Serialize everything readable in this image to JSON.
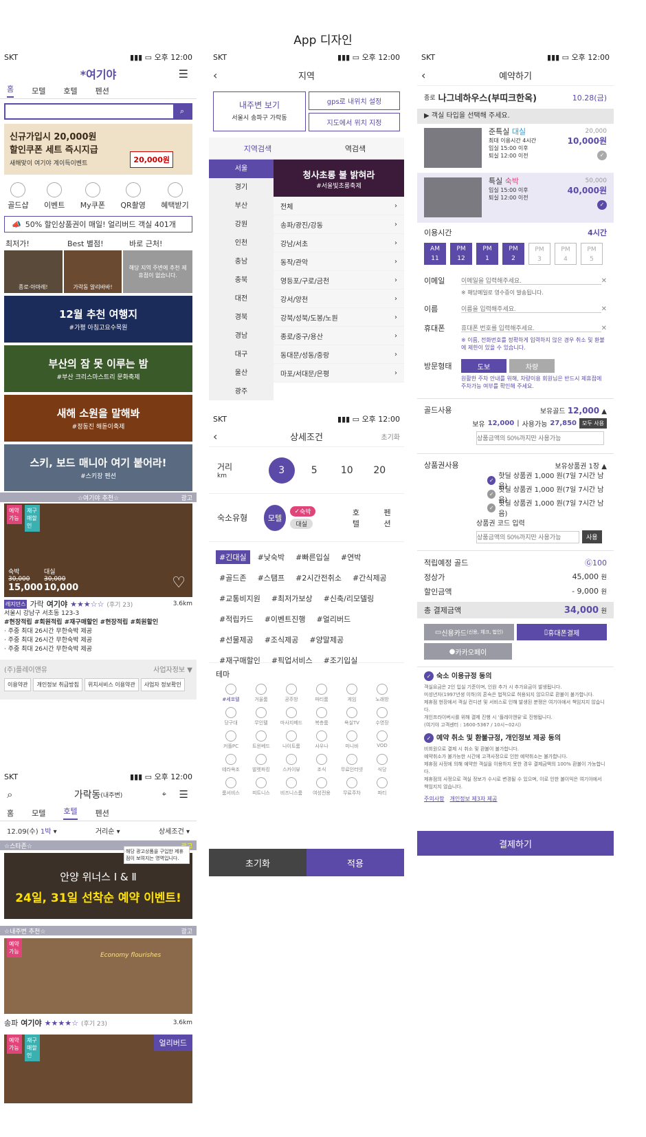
{
  "page_title": "App 디자인",
  "status": {
    "carrier": "SKT",
    "time": "오후 12:00"
  },
  "home": {
    "logo": "여기야",
    "tabs": [
      "홈",
      "모텔",
      "호텔",
      "펜션"
    ],
    "promo": {
      "line1": "신규가입시 20,000원",
      "line2": "할인쿠폰 세트 즉시지급",
      "sub": "새해맞이 여기야 계이득이벤트",
      "amount": "20,000원"
    },
    "quick": [
      "골드샵",
      "이벤트",
      "My쿠폰",
      "QR촬영",
      "혜택받기"
    ],
    "notice": "50% 할인상품권이 매일! 얼리버드 객실 401개",
    "recs": {
      "labels": [
        "최저가!",
        "Best 별점!",
        "바로 근처!"
      ],
      "thumb1": "종로·아마레!",
      "thumb2": "가락동 알리바바!",
      "thumb3": "해당 지역 주변에 추천 제휴점이 없습니다."
    },
    "banners": [
      {
        "title": "12월 추천 여행지",
        "tag": "#가평 아침고요수목원",
        "bg": "#1b2b5a"
      },
      {
        "title": "부산의 잠 못 이루는 밤",
        "tag": "#부산 크리스마스트리 문화축제",
        "bg": "#3a5a2a"
      },
      {
        "title": "새해 소원을 말해봐",
        "tag": "#정동진 해돋이축제",
        "bg": "#7a3a14"
      },
      {
        "title": "스키, 보드 매니아 여기 붙어라!",
        "tag": "#스키장 펜션",
        "bg": "#5a6a80"
      }
    ],
    "section": "☆여기야 추천☆",
    "ad": "광고",
    "card": {
      "badge1": "예약가능",
      "badge2": "재구매할인",
      "stay_label": "숙박",
      "stay_old": "30,000",
      "stay_price": "15,000",
      "day_label": "대실",
      "day_old": "30,000",
      "day_price": "10,000",
      "tag": "레지던스",
      "name_pre": "가락",
      "name": "여기야",
      "reviews": "(후기 23)",
      "dist": "3.6km",
      "addr": "서울시 강남구 서초동 123-3",
      "tags": "#현장적립 #회원적립 #재구매할인 #현장적립 #회원할인",
      "bullets": [
        "· 주중 최대 26시간 무한숙박 제공",
        "· 주중 최대 26시간 무한숙박 제공",
        "· 주중 최대 26시간 무한숙박 제공"
      ]
    },
    "footer": {
      "company": "(주)플레이앤유",
      "info": "사업자정보 ▼",
      "links": [
        "이용약관",
        "개인정보 취급방침",
        "위치서비스 이용약관",
        "사업자 정보확인"
      ]
    }
  },
  "list": {
    "location": "가락동",
    "loc_sub": "(내주변)",
    "tabs": [
      "홈",
      "모텔",
      "호텔",
      "펜션"
    ],
    "filters": {
      "date": "12.09(수)",
      "nights": "1박",
      "sort": "거리순",
      "detail": "상세조건"
    },
    "section1": "☆스타존☆",
    "ad": "광고",
    "tooltip": "해당 광고상품을 구입한 제휴점이 보여지는 영역입니다.",
    "star": {
      "title": "안양 위너스 Ⅰ & Ⅱ",
      "event": "24일, 31일 선착순 예약 이벤트!"
    },
    "section2": "☆내주변 추천☆",
    "card": {
      "badge": "예약가능",
      "sign": "Economy flourishes",
      "area": "송파",
      "name": "여기야",
      "reviews": "(후기 23)",
      "dist": "3.6km"
    },
    "card2": {
      "badge1": "예약가능",
      "badge2": "재구매할인",
      "label": "얼리버드"
    }
  },
  "region": {
    "header": "지역",
    "nearby": {
      "title": "내주변 보기",
      "addr": "서울시 송파구 가락동"
    },
    "gps": "gps로 내위치 설정",
    "map": "지도에서 위치 지정",
    "tabs": [
      "지역검색",
      "역검색"
    ],
    "left": [
      "서울",
      "경기",
      "부산",
      "강원",
      "인천",
      "충남",
      "충북",
      "대전",
      "경북",
      "경남",
      "대구",
      "울산",
      "광주"
    ],
    "festival": {
      "title": "청사초롱 불 밝혀라",
      "tag": "#서울빛초롱축제"
    },
    "right": [
      "전체",
      "송파/광진/강동",
      "강남/서초",
      "동작/관악",
      "영등포/구로/금천",
      "강서/양천",
      "강북/성북/도봉/노원",
      "종로/중구/용산",
      "동대문/성동/중랑",
      "마포/서대문/은평"
    ]
  },
  "detail": {
    "header": "상세조건",
    "reset_top": "초기화",
    "distance": {
      "label": "거리",
      "unit": "km",
      "values": [
        "3",
        "5",
        "10",
        "20"
      ],
      "selected": 0
    },
    "type": {
      "label": "숙소유형",
      "motel": "모텔",
      "sukbak": "숙박",
      "daesil": "대실",
      "hotel": "호텔",
      "pension": "펜션"
    },
    "chips": [
      "#긴대실",
      "#낮숙박",
      "#빠른입실",
      "#연박",
      "#골드존",
      "#스탬프",
      "#2시간전취소",
      "#간식제공",
      "#교통비지원",
      "#최저가보상",
      "#신축/리모델링",
      "#적립카드",
      "#이벤트진행",
      "#얼리버드",
      "#선물제공",
      "#조식제공",
      "#양말제공",
      "#재구매할인",
      "#픽업서비스",
      "#조기입실"
    ],
    "theme_label": "테마",
    "themes": [
      "#세호텔",
      "거울룸",
      "공주방",
      "파티룸",
      "게임",
      "노래방",
      "당구대",
      "무인텔",
      "마사지베드",
      "복층룸",
      "욕실TV",
      "수영장",
      "커플PC",
      "트윈베드",
      "나이트룸",
      "사우나",
      "미니바",
      "VOD",
      "테라욕조",
      "발렛파킹",
      "스카이뷰",
      "조식",
      "무료인터넷",
      "식당",
      "룸서비스",
      "피트니스",
      "비즈니스룸",
      "여성전용",
      "무료주차",
      "파티"
    ],
    "reset": "초기화",
    "apply": "적용"
  },
  "booking": {
    "header": "예약하기",
    "hotel": {
      "area": "종로",
      "name": "나그네하우스(부띠크한옥)",
      "date": "10.28(금)"
    },
    "select_msg": "▶ 객실 타입을 선택해 주세요.",
    "rooms": [
      {
        "name": "준특실",
        "type": "대실",
        "info1": "최대 이용시간 4시간",
        "info2": "입실 15:00 이후",
        "info3": "퇴실 12:00 이전",
        "old": "20,000",
        "price": "10,000원"
      },
      {
        "name": "특실",
        "type": "숙박",
        "info1": "입실 15:00 이후",
        "info2": "퇴실 12:00 이전",
        "info3": "",
        "old": "50,000",
        "price": "40,000원"
      }
    ],
    "time_label": "이용시간",
    "time_value": "4시간",
    "times": [
      {
        "p": "AM",
        "h": "11",
        "on": true
      },
      {
        "p": "PM",
        "h": "12",
        "on": true
      },
      {
        "p": "PM",
        "h": "1",
        "on": true
      },
      {
        "p": "PM",
        "h": "2",
        "on": true
      },
      {
        "p": "PM",
        "h": "3",
        "on": false
      },
      {
        "p": "PM",
        "h": "4",
        "on": false
      },
      {
        "p": "PM",
        "h": "5",
        "on": false
      }
    ],
    "email": {
      "label": "이메일",
      "ph": "이메일을 입력해주세요.",
      "note": "※ 해당메일로 영수증이 발송됩니다."
    },
    "name": {
      "label": "이름",
      "ph": "이름을 입력해주세요."
    },
    "phone": {
      "label": "휴대폰",
      "ph": "휴대폰 번호를 입력해주세요.",
      "note": "※ 이름, 전화번호를 정확하게 입력하지 않은 경우 취소 및 환불에 제한이 있을 수 있습니다."
    },
    "visit": {
      "label": "방문형태",
      "walk": "도보",
      "car": "차량",
      "note": "원활한 주차 안내를 위해, 차량이용 회원님은 반드시 제휴점에 주차가능 여부를 확인해 주세요."
    },
    "gold": {
      "label": "골드사용",
      "own_label": "보유골드",
      "own": "12,000",
      "have_label": "보유",
      "have": "12,000",
      "use_label": "사용가능",
      "use": "27,850",
      "all": "모두 사용",
      "ph": "상품금액의 50%까지만 사용가능"
    },
    "voucher": {
      "label": "상품권사용",
      "own": "보유상품권 1장",
      "items": [
        "핫딜 상품권 1,000 원(7일 7시간 남음)",
        "핫딜 상품권 1,000 원(7일 7시간 남음)",
        "핫딜 상품권 1,000 원(7일 7시간 남음)"
      ],
      "code_label": "상품권 코드 입력",
      "ph": "상품금액의 50%까지만 사용가능",
      "use": "사용"
    },
    "summary": {
      "gold_label": "적립예정 골드",
      "gold": "100",
      "price_label": "정상가",
      "price": "45,000",
      "disc_label": "할인금액",
      "disc": "- 9,000",
      "total_label": "총 결제금액",
      "total": "34,000",
      "won": "원"
    },
    "pay": {
      "card": "신용카드",
      "card_sub": "(신용, 체크, 법인)",
      "phone": "휴대폰결제",
      "kakao": "카카오페이"
    },
    "agree1": {
      "title": "숙소 이용규정 동의",
      "lines": [
        "객실요금은 2인 입실 기준이며, 인원 추가 시 추가요금이 발생됩니다.",
        "미성년자(1997년생 이하)의 혼숙은 법적으로 허용되지 않으므로 환불이 불가합니다.",
        "제휴점 현장에서 객실 컨디션 및 서비스로 인해 발생된 분쟁은 여기야에서 책임지지 않습니다.",
        "개인프라이버시를 위해 결제 진행 시 '플레이앤유'로 진행됩니다.",
        "(여기야 고객센터 : 1600-5367 / 10시~02시)"
      ]
    },
    "agree2": {
      "title": "예약 취소 및 환불규정, 개인정보 제공 동의",
      "lines": [
        "비회원으로 결제 시 취소 및 환불이 불가합니다.",
        "예약취소가 불가능한 시간에 고객사정으로 인한 예약취소는 불가합니다.",
        "제휴점 사정에 의해 예약한 객실을 이용하지 못한 경우 결제금액의 100% 환불이 가능합니다.",
        "제휴점의 사정으로 객실 정보가 수시로 변경될 수 있으며, 이로 인한 불이익은 여기야에서 책임지지 않습니다."
      ]
    },
    "link1": "주의사항",
    "link2": "개인정보 제3자 제공",
    "submit": "결제하기"
  }
}
